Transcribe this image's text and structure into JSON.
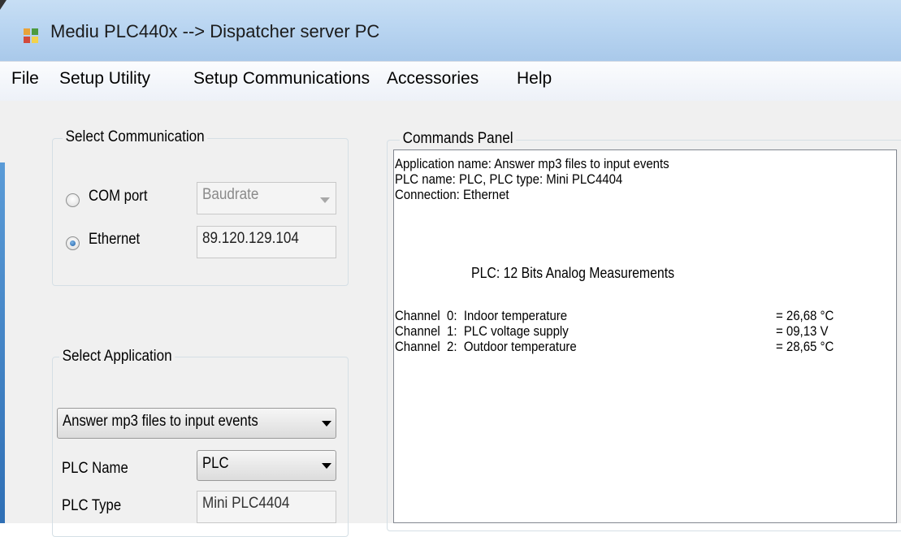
{
  "window": {
    "title": "Mediu PLC440x --> Dispatcher server PC"
  },
  "menu": [
    "File",
    "Setup Utility",
    "Setup Communications",
    "Accessories",
    "Help"
  ],
  "select_communication": {
    "title": "Select Communication",
    "com_port_label": "COM port",
    "baudrate_placeholder": "Baudrate",
    "ethernet_label": "Ethernet",
    "ip_address": "89.120.129.104",
    "selected": "Ethernet"
  },
  "select_application": {
    "title": "Select Application",
    "application": "Answer mp3 files to input events",
    "plc_name_label": "PLC Name",
    "plc_name": "PLC",
    "plc_type_label": "PLC Type",
    "plc_type": "Mini PLC4404"
  },
  "commands_panel": {
    "title": "Commands Panel",
    "app_line": "Application name: Answer mp3 files to input events",
    "plc_line": "PLC name: PLC, PLC type: Mini PLC4404",
    "connection_line": "Connection: Ethernet",
    "measure_title": "PLC: 12 Bits Analog Measurements",
    "channels": [
      {
        "label": "Channel  0:  Indoor temperature",
        "value": "= 26,68 °C"
      },
      {
        "label": "Channel  1:  PLC voltage supply",
        "value": "= 09,13 V"
      },
      {
        "label": "Channel  2:  Outdoor temperature",
        "value": "= 28,65 °C"
      }
    ]
  },
  "colors": {
    "title_bar": "#b9d5f1",
    "selection_blue": "#1d5fa5"
  }
}
